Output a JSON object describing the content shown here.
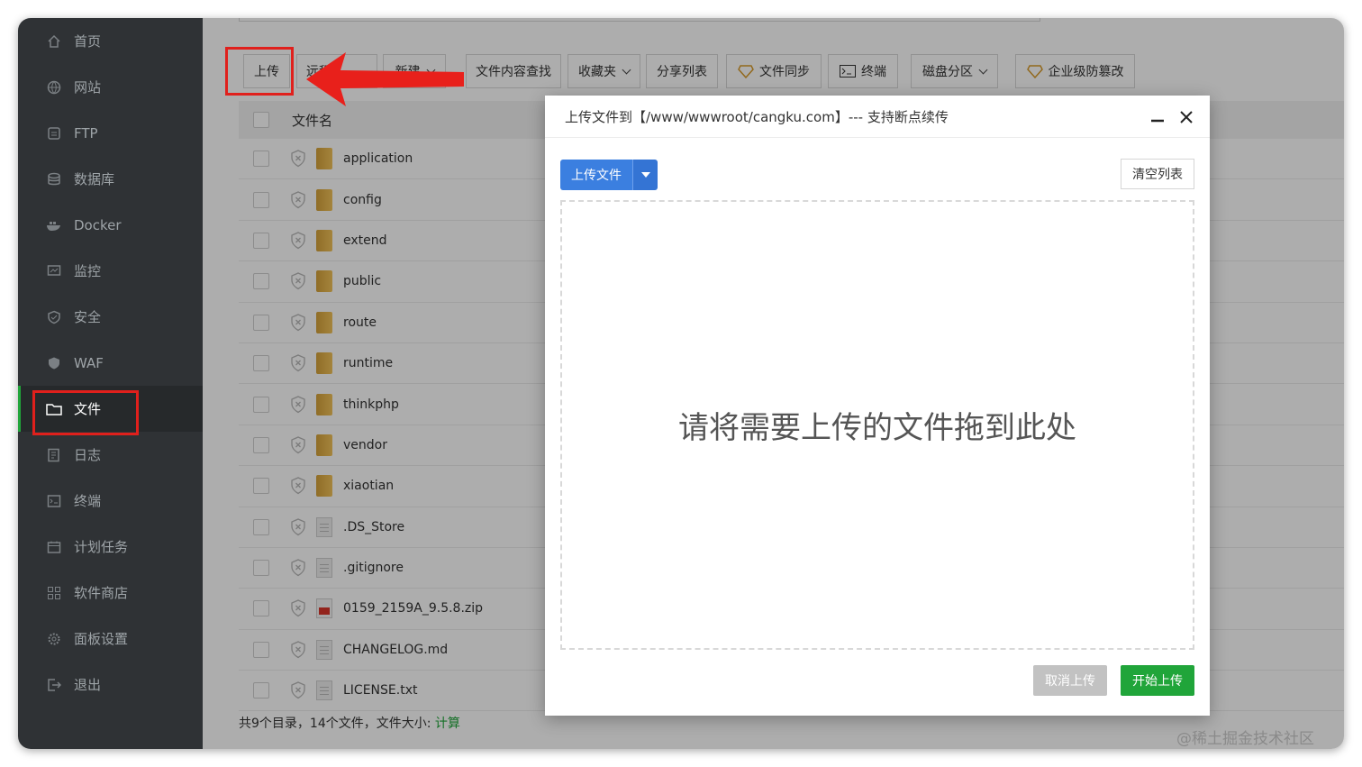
{
  "sidebar": {
    "items": [
      {
        "label": "首页",
        "icon": "home-icon"
      },
      {
        "label": "网站",
        "icon": "globe-icon"
      },
      {
        "label": "FTP",
        "icon": "ftp-icon"
      },
      {
        "label": "数据库",
        "icon": "database-icon"
      },
      {
        "label": "Docker",
        "icon": "docker-icon"
      },
      {
        "label": "监控",
        "icon": "monitor-icon"
      },
      {
        "label": "安全",
        "icon": "shield-icon"
      },
      {
        "label": "WAF",
        "icon": "waf-icon"
      },
      {
        "label": "文件",
        "icon": "folder-icon",
        "active": true
      },
      {
        "label": "日志",
        "icon": "log-icon"
      },
      {
        "label": "终端",
        "icon": "terminal-icon"
      },
      {
        "label": "计划任务",
        "icon": "calendar-icon"
      },
      {
        "label": "软件商店",
        "icon": "apps-icon"
      },
      {
        "label": "面板设置",
        "icon": "settings-icon"
      },
      {
        "label": "退出",
        "icon": "logout-icon"
      }
    ]
  },
  "toolbar": {
    "upload": "上传",
    "remote": "远程",
    "new": "新建",
    "search_content": "文件内容查找",
    "favorites": "收藏夹",
    "share_list": "分享列表",
    "file_sync": "文件同步",
    "terminal": "终端",
    "disk_partition": "磁盘分区",
    "tamper_proof": "企业级防篡改"
  },
  "table": {
    "header_name": "文件名",
    "rows": [
      {
        "name": "application",
        "type": "folder"
      },
      {
        "name": "config",
        "type": "folder"
      },
      {
        "name": "extend",
        "type": "folder"
      },
      {
        "name": "public",
        "type": "folder"
      },
      {
        "name": "route",
        "type": "folder"
      },
      {
        "name": "runtime",
        "type": "folder"
      },
      {
        "name": "thinkphp",
        "type": "folder"
      },
      {
        "name": "vendor",
        "type": "folder"
      },
      {
        "name": "xiaotian",
        "type": "folder"
      },
      {
        "name": ".DS_Store",
        "type": "file"
      },
      {
        "name": ".gitignore",
        "type": "file"
      },
      {
        "name": "0159_2159A_9.5.8.zip",
        "type": "zip"
      },
      {
        "name": "CHANGELOG.md",
        "type": "file"
      },
      {
        "name": "LICENSE.txt",
        "type": "file"
      }
    ]
  },
  "footer": {
    "summary": "共9个目录，14个文件，文件大小: ",
    "calc_link": "计算"
  },
  "modal": {
    "title": "上传文件到【/www/wwwroot/cangku.com】--- 支持断点续传",
    "upload_button": "上传文件",
    "clear_button": "清空列表",
    "drop_hint": "请将需要上传的文件拖到此处",
    "cancel_button": "取消上传",
    "start_button": "开始上传"
  },
  "watermark": "@稀土掘金技术社区",
  "colors": {
    "accent_green": "#20a53a",
    "primary_blue": "#3b7fe0",
    "highlight_red": "#e0201c"
  }
}
